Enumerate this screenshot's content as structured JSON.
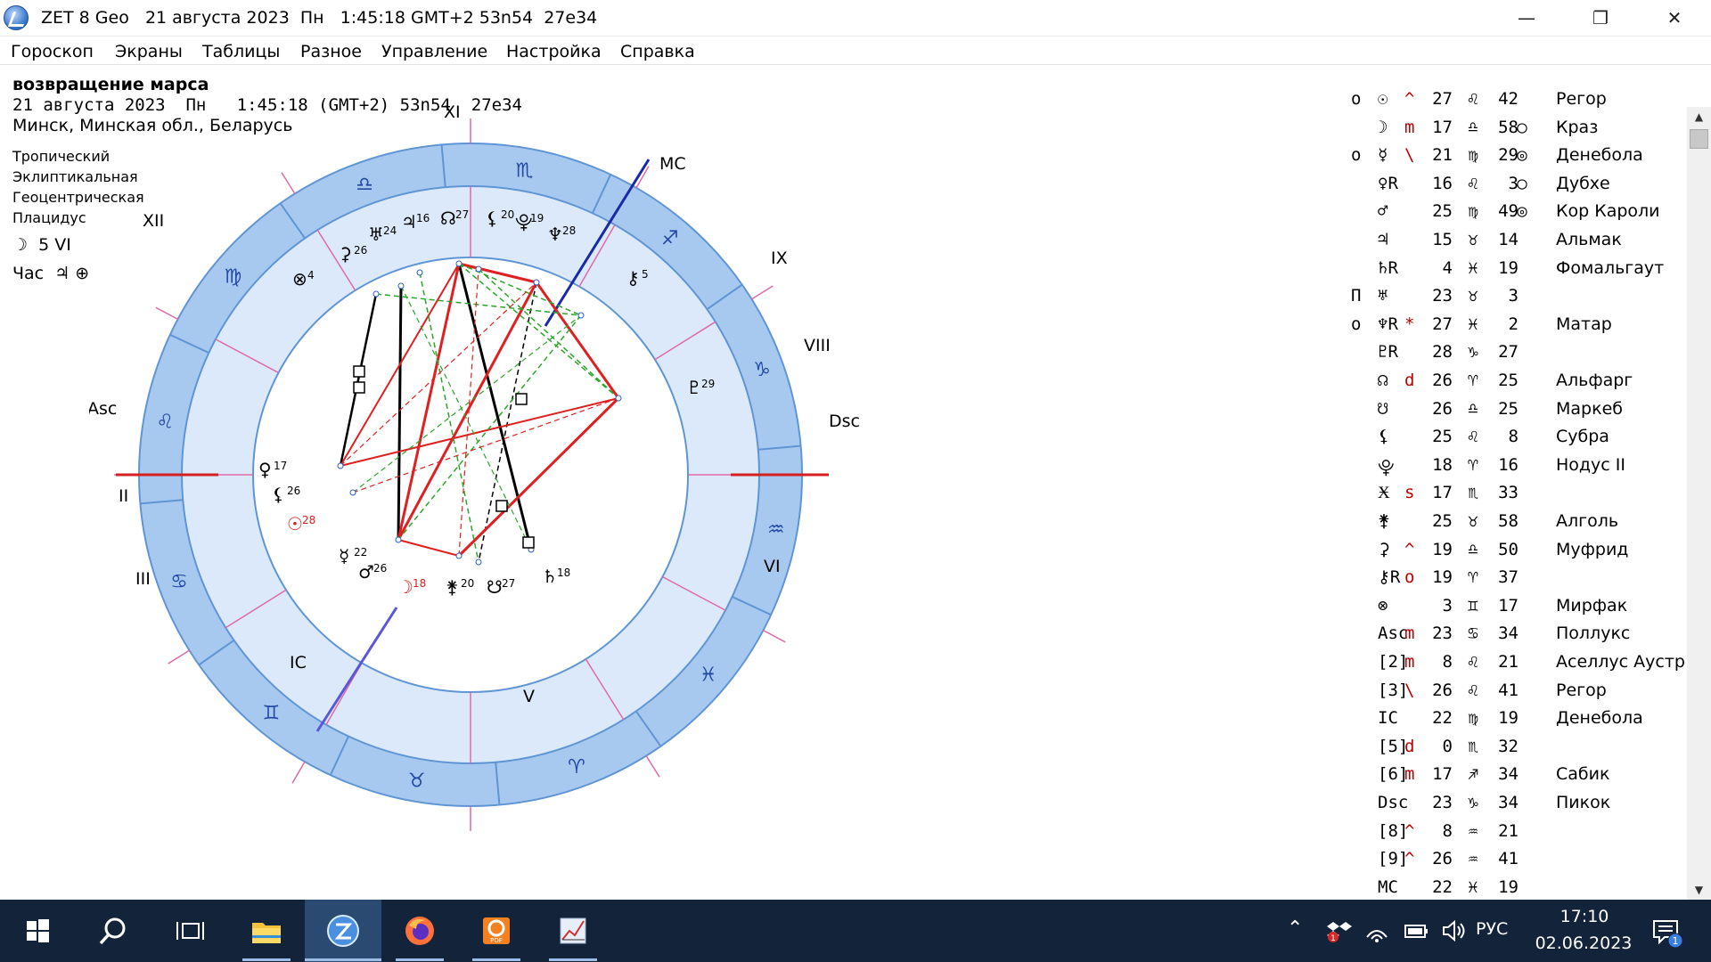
{
  "window": {
    "title": "ZET 8 Geo   21 августа 2023  Пн   1:45:18 GMT+2 53n54  27e34",
    "minimize_label": "—",
    "maximize_label": "❐",
    "close_label": "✕"
  },
  "menu": [
    "Гороскоп",
    "Экраны",
    "Таблицы",
    "Разное",
    "Управление",
    "Настройка",
    "Справка"
  ],
  "chart_info": {
    "title": "возвращение марса",
    "date_line": "21 августа 2023  Пн   1:45:18 (GMT+2) 53n54  27e34",
    "place": "Минск, Минская обл., Беларусь",
    "systems": [
      "Тропический",
      "Эклиптикальная",
      "Геоцентрическая",
      "Плацидус"
    ],
    "moon_phase": "☽  5 VI",
    "hour": "Час  ♃ ⊕"
  },
  "wheel": {
    "house_labels": {
      "asc": "Asc",
      "dsc": "Dsc",
      "mc": "MC",
      "ic": "IC",
      "xi": "XI",
      "xii": "XII",
      "ix": "IX",
      "viii": "VIII",
      "ii": "II",
      "iii": "III",
      "vi": "VI",
      "v": "V"
    },
    "zodiac_signs": [
      "♈",
      "♉",
      "♊",
      "♋",
      "♌",
      "♍",
      "♎",
      "♏",
      "♐",
      "♑",
      "♒",
      "♓"
    ],
    "planet_labels": [
      {
        "glyph": "♆",
        "num": "28"
      },
      {
        "glyph": "♇",
        "num": "29"
      },
      {
        "glyph": "⚷",
        "num": "5"
      },
      {
        "glyph": "♃",
        "num": "16"
      },
      {
        "glyph": "♅",
        "num": "24"
      },
      {
        "glyph": "⚳",
        "num": "26"
      },
      {
        "glyph": "⊗",
        "num": "4"
      },
      {
        "glyph": "☊",
        "num": "27"
      },
      {
        "glyph": "⚸",
        "num": "20"
      },
      {
        "glyph": "⯓",
        "num": "19"
      },
      {
        "glyph": "♀",
        "num": "17"
      },
      {
        "glyph": "⚸",
        "num": "26"
      },
      {
        "glyph": "☉",
        "num": "28"
      },
      {
        "glyph": "☿",
        "num": "22"
      },
      {
        "glyph": "♂",
        "num": "26"
      },
      {
        "glyph": "☽",
        "num": "18"
      },
      {
        "glyph": "⚵",
        "num": "20"
      },
      {
        "glyph": "☋",
        "num": "27"
      },
      {
        "glyph": "♄",
        "num": "18"
      }
    ]
  },
  "table_rows": [
    {
      "mark": "о",
      "glyph": "☉",
      "pre": "^",
      "deg": "27",
      "sign": "♌",
      "min": "42",
      "star": "",
      "fixed": "Регор"
    },
    {
      "mark": "",
      "glyph": "☽",
      "pre": "m",
      "deg": "17",
      "sign": "♎",
      "min": "58",
      "star": "○",
      "fixed": "Краз"
    },
    {
      "mark": "о",
      "glyph": "☿",
      "pre": "\\",
      "deg": "21",
      "sign": "♍",
      "min": "29",
      "star": "◎",
      "fixed": "Денебола"
    },
    {
      "mark": "",
      "glyph": "♀R",
      "pre": "",
      "deg": "16",
      "sign": "♌",
      "min": "3",
      "star": "○",
      "fixed": "Дубхе"
    },
    {
      "mark": "",
      "glyph": "♂",
      "pre": "",
      "deg": "25",
      "sign": "♍",
      "min": "49",
      "star": "◎",
      "fixed": "Кор Кароли"
    },
    {
      "mark": "",
      "glyph": "♃",
      "pre": "",
      "deg": "15",
      "sign": "♉",
      "min": "14",
      "star": "",
      "fixed": "Альмак"
    },
    {
      "mark": "",
      "glyph": "♄R",
      "pre": "",
      "deg": "4",
      "sign": "♓",
      "min": "19",
      "star": "",
      "fixed": "Фомальгаут"
    },
    {
      "mark": "П",
      "glyph": "♅",
      "pre": "",
      "deg": "23",
      "sign": "♉",
      "min": "3",
      "star": "",
      "fixed": ""
    },
    {
      "mark": "о",
      "glyph": "♆R",
      "pre": "*",
      "deg": "27",
      "sign": "♓",
      "min": "2",
      "star": "",
      "fixed": "Матар"
    },
    {
      "mark": "",
      "glyph": "♇R",
      "pre": "",
      "deg": "28",
      "sign": "♑",
      "min": "27",
      "star": "",
      "fixed": ""
    },
    {
      "mark": "",
      "glyph": "☊",
      "pre": "d",
      "deg": "26",
      "sign": "♈",
      "min": "25",
      "star": "",
      "fixed": "Альфарг"
    },
    {
      "mark": "",
      "glyph": "☋",
      "pre": "",
      "deg": "26",
      "sign": "♎",
      "min": "25",
      "star": "",
      "fixed": "Маркеб"
    },
    {
      "mark": "",
      "glyph": "⚸",
      "pre": "",
      "deg": "25",
      "sign": "♌",
      "min": "8",
      "star": "",
      "fixed": "Субра"
    },
    {
      "mark": "",
      "glyph": "⯓",
      "pre": "",
      "deg": "18",
      "sign": "♈",
      "min": "16",
      "star": "",
      "fixed": "Нодус II"
    },
    {
      "mark": "",
      "glyph": "Ӿ",
      "pre": "s",
      "deg": "17",
      "sign": "♏",
      "min": "33",
      "star": "",
      "fixed": ""
    },
    {
      "mark": "",
      "glyph": "⚵",
      "pre": "",
      "deg": "25",
      "sign": "♉",
      "min": "58",
      "star": "",
      "fixed": "Алголь"
    },
    {
      "mark": "",
      "glyph": "⚳",
      "pre": "^",
      "deg": "19",
      "sign": "♎",
      "min": "50",
      "star": "",
      "fixed": "Муфрид"
    },
    {
      "mark": "",
      "glyph": "⚷R",
      "pre": "о",
      "deg": "19",
      "sign": "♈",
      "min": "37",
      "star": "",
      "fixed": ""
    },
    {
      "mark": "",
      "glyph": "⊗",
      "pre": "",
      "deg": "3",
      "sign": "♊",
      "min": "17",
      "star": "",
      "fixed": "Мирфак"
    },
    {
      "mark": "",
      "glyph": "Asc",
      "pre": "m",
      "deg": "23",
      "sign": "♋",
      "min": "34",
      "star": "",
      "fixed": "Поллукс"
    },
    {
      "mark": "",
      "glyph": "[2]",
      "pre": "m",
      "deg": "8",
      "sign": "♌",
      "min": "21",
      "star": "",
      "fixed": "Аселлус Аустр"
    },
    {
      "mark": "",
      "glyph": "[3]",
      "pre": "\\",
      "deg": "26",
      "sign": "♌",
      "min": "41",
      "star": "",
      "fixed": "Регор"
    },
    {
      "mark": "",
      "glyph": "IC",
      "pre": "",
      "deg": "22",
      "sign": "♍",
      "min": "19",
      "star": "",
      "fixed": "Денебола"
    },
    {
      "mark": "",
      "glyph": "[5]",
      "pre": "d",
      "deg": "0",
      "sign": "♏",
      "min": "32",
      "star": "",
      "fixed": ""
    },
    {
      "mark": "",
      "glyph": "[6]",
      "pre": "m",
      "deg": "17",
      "sign": "♐",
      "min": "34",
      "star": "",
      "fixed": "Сабик"
    },
    {
      "mark": "",
      "glyph": "Dsc",
      "pre": "",
      "deg": "23",
      "sign": "♑",
      "min": "34",
      "star": "",
      "fixed": "Пикок"
    },
    {
      "mark": "",
      "glyph": "[8]",
      "pre": "^",
      "deg": "8",
      "sign": "♒",
      "min": "21",
      "star": "",
      "fixed": ""
    },
    {
      "mark": "",
      "glyph": "[9]",
      "pre": "^",
      "deg": "26",
      "sign": "♒",
      "min": "41",
      "star": "",
      "fixed": ""
    },
    {
      "mark": "",
      "glyph": "MC",
      "pre": "",
      "deg": "22",
      "sign": "♓",
      "min": "19",
      "star": "",
      "fixed": ""
    }
  ],
  "taskbar": {
    "apps": [
      "start-icon",
      "search-icon",
      "task-view-icon",
      "file-explorer-icon",
      "zet-app-icon",
      "firefox-icon",
      "pdf-app-icon",
      "chart-app-icon"
    ],
    "language": "РУС",
    "time": "17:10",
    "date": "02.06.2023",
    "notification_count": "1"
  }
}
